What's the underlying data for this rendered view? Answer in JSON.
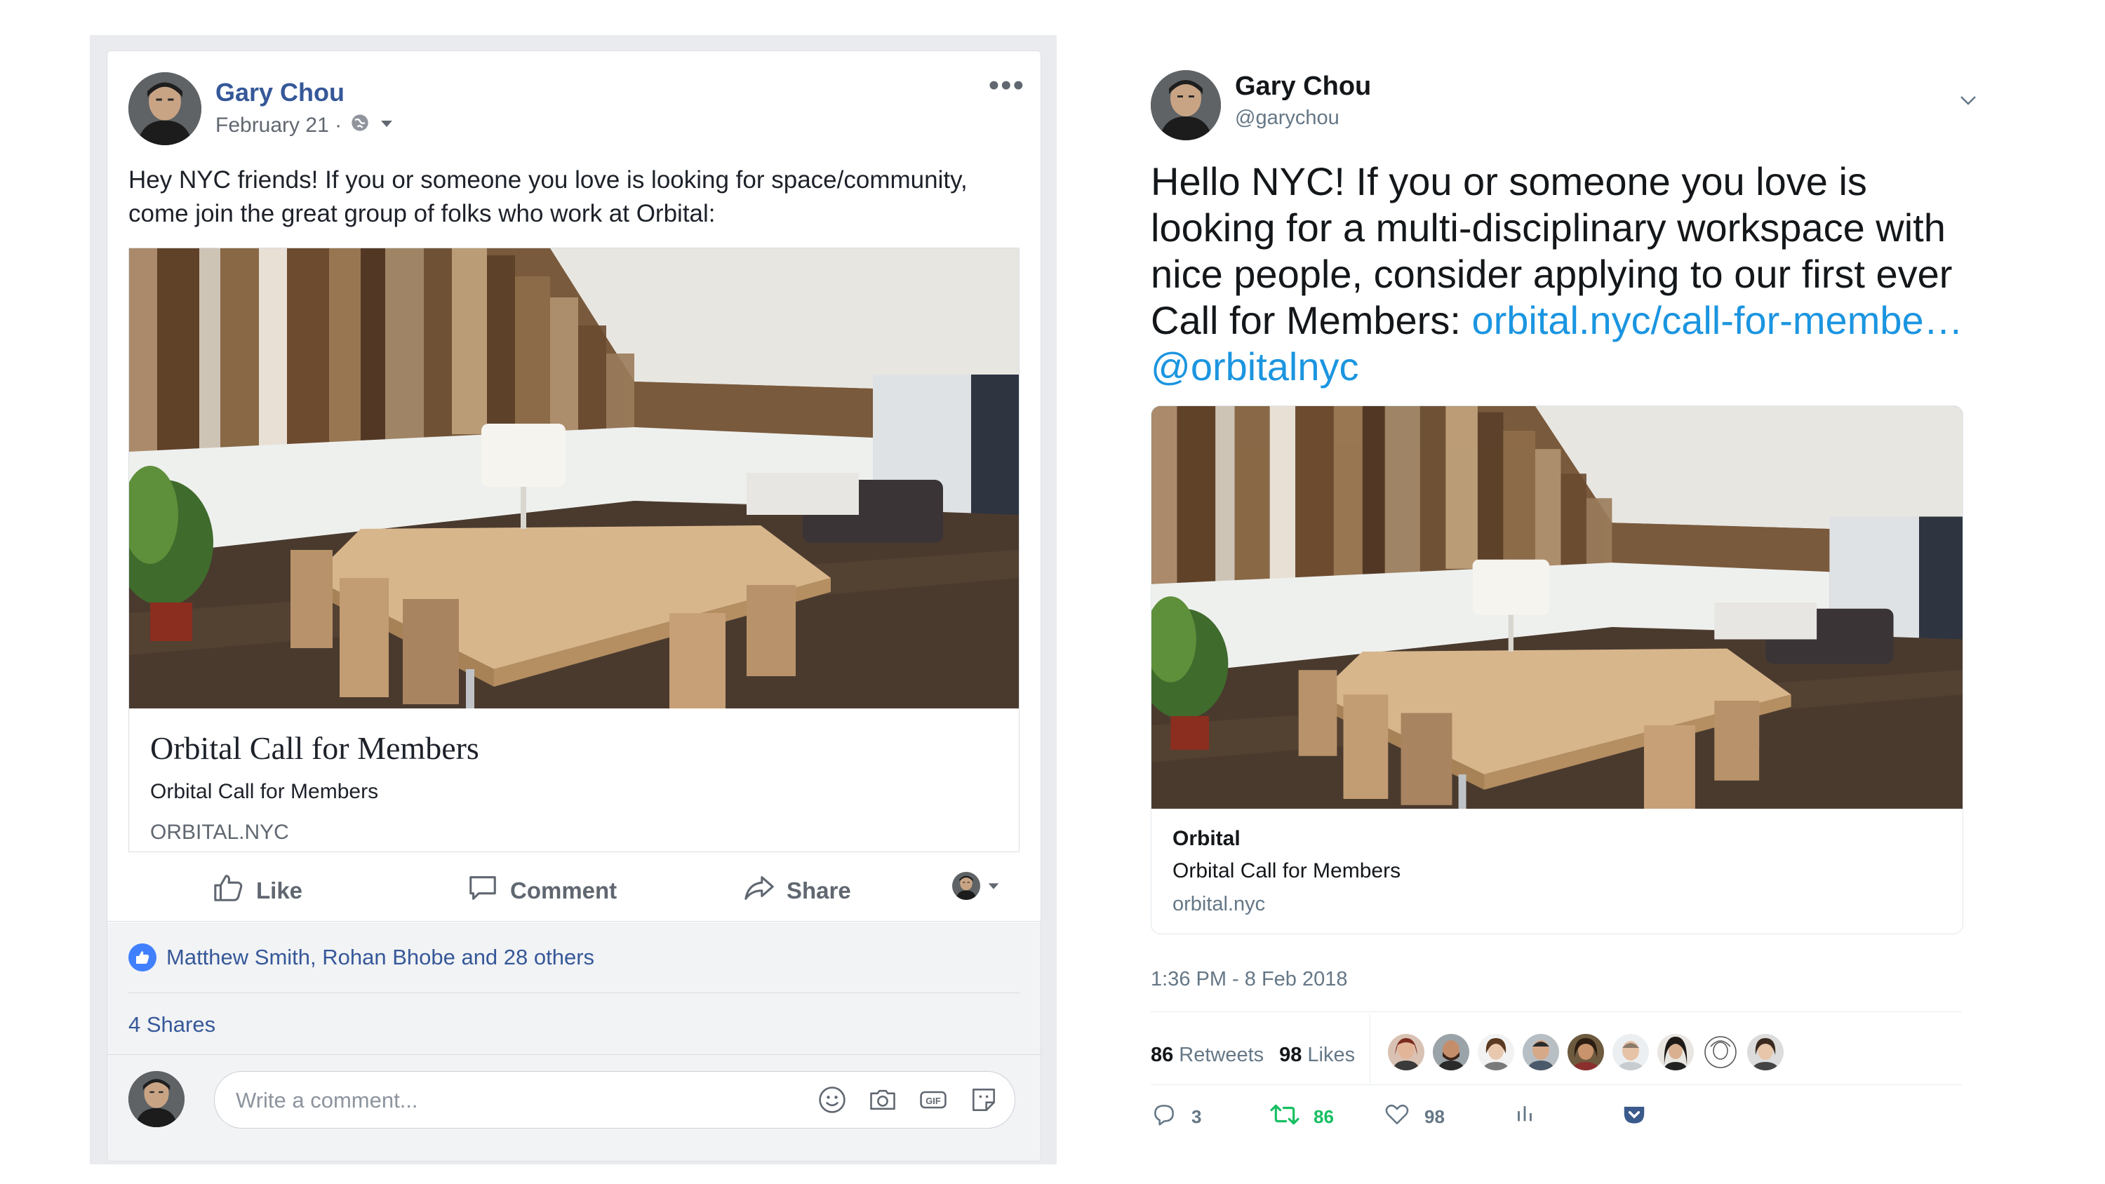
{
  "facebook": {
    "author": "Gary Chou",
    "date": "February 21 ·",
    "post_text": "Hey NYC friends! If you or someone you love is looking for space/community, come join the great group of folks who work at Orbital:",
    "link_title": "Orbital Call for Members",
    "link_description": "Orbital Call for Members",
    "link_domain": "ORBITAL.NYC",
    "actions": {
      "like": "Like",
      "comment": "Comment",
      "share": "Share"
    },
    "likes_text": "Matthew Smith, Rohan Bhobe and 28 others",
    "shares_text": "4 Shares",
    "comment_placeholder": "Write a comment...",
    "accent_color": "#365899"
  },
  "twitter": {
    "author": "Gary Chou",
    "handle": "@garychou",
    "tweet_text": "Hello NYC! If you or someone you love is looking for a multi-disciplinary workspace with nice people, consider applying to our first ever Call for Members:",
    "tweet_link": "orbital.nyc/call-for-membe…",
    "tweet_mention": "@orbitalnyc",
    "card_title": "Orbital",
    "card_description": "Orbital Call for Members",
    "card_domain": "orbital.nyc",
    "timestamp": "1:36 PM - 8 Feb 2018",
    "retweets_count": "86",
    "retweets_label": "Retweets",
    "likes_count": "98",
    "likes_label": "Likes",
    "reply_count": "3",
    "retweet_action_count": "86",
    "like_action_count": "98",
    "link_color": "#1b95e0",
    "retweet_color": "#17bf63"
  }
}
